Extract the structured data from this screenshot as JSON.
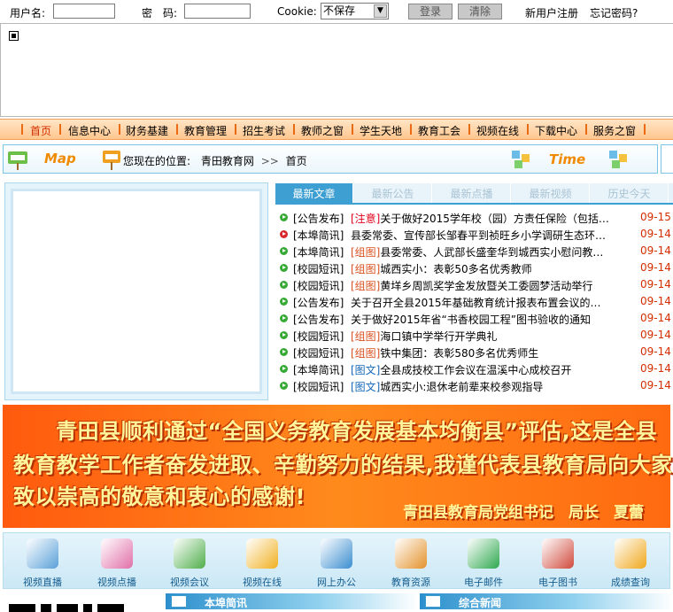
{
  "login": {
    "username_label": "用户名:",
    "password_label": "密　码:",
    "cookie_label": "Cookie:",
    "cookie_value": "不保存",
    "login_button": "登录",
    "clear_button": "清除",
    "register_link": "新用户注册",
    "forgot_link": "忘记密码?"
  },
  "nav": {
    "items": [
      "首页",
      "信息中心",
      "财务基建",
      "教育管理",
      "招生考试",
      "教师之窗",
      "学生天地",
      "教育工会",
      "视频在线",
      "下载中心",
      "服务之窗"
    ]
  },
  "location": {
    "map_text": "Map",
    "prefix": "您现在的位置:",
    "site": "青田教育网",
    "separator": ">>",
    "current": "首页",
    "time_text": "Time"
  },
  "tabs": [
    "最新文章",
    "最新公告",
    "最新点播",
    "最新视频",
    "历史今天"
  ],
  "news": [
    {
      "cat": "[公告发布]",
      "tag": "[注意]",
      "tag_color": "red",
      "title": "关于做好2015学年校（园）方责任保险（包括…",
      "date": "09-15",
      "icon": "green"
    },
    {
      "cat": "[本埠简讯]",
      "tag": "",
      "tag_color": "",
      "title": "县委常委、宣传部长邹春平到祯旺乡小学调研生态环…",
      "date": "09-14",
      "icon": "red"
    },
    {
      "cat": "[本埠简讯]",
      "tag": "[组图]",
      "tag_color": "red",
      "title": "县委常委、人武部长盛奎华到城西实小慰问教…",
      "date": "09-14",
      "icon": "green"
    },
    {
      "cat": "[校园短讯]",
      "tag": "[组图]",
      "tag_color": "red",
      "title": "城西实小：表彰50多名优秀教师",
      "date": "09-14",
      "icon": "green"
    },
    {
      "cat": "[校园短讯]",
      "tag": "[组图]",
      "tag_color": "red",
      "title": "黄垟乡周凯奖学金发放暨关工委圆梦活动举行",
      "date": "09-14",
      "icon": "green"
    },
    {
      "cat": "[公告发布]",
      "tag": "",
      "tag_color": "",
      "title": "关于召开全县2015年基础教育统计报表布置会议的通…",
      "date": "09-14",
      "icon": "green"
    },
    {
      "cat": "[公告发布]",
      "tag": "",
      "tag_color": "",
      "title": "关于做好2015年省“书香校园工程”图书验收的通知",
      "date": "09-14",
      "icon": "green"
    },
    {
      "cat": "[校园短讯]",
      "tag": "[组图]",
      "tag_color": "red",
      "title": "海口镇中学举行开学典礼",
      "date": "09-14",
      "icon": "green"
    },
    {
      "cat": "[校园短讯]",
      "tag": "[组图]",
      "tag_color": "red",
      "title": "铁中集团：表彰580多名优秀师生",
      "date": "09-14",
      "icon": "green"
    },
    {
      "cat": "[本埠简讯]",
      "tag": "[图文]",
      "tag_color": "blue",
      "title": "全县成技校工作会议在温溪中心成校召开",
      "date": "09-14",
      "icon": "green"
    },
    {
      "cat": "[校园短讯]",
      "tag": "[图文]",
      "tag_color": "blue",
      "title": "城西实小:退休老前辈来校参观指导",
      "date": "09-14",
      "icon": "green"
    }
  ],
  "banner": {
    "line1": "青田县顺利通过“全国义务教育发展基本均衡县”评估,这是全县",
    "line2": "教育教学工作者奋发进取、辛勤努力的结果,我谨代表县教育局向大家",
    "line3": "致以崇高的敬意和衷心的感谢!",
    "signature": "青田县教育局党组书记　局长　夏蕾"
  },
  "services": [
    {
      "label": "视频直播",
      "color": "#5aa0d8"
    },
    {
      "label": "视频点播",
      "color": "#e16fa8"
    },
    {
      "label": "视频会议",
      "color": "#4fae4a"
    },
    {
      "label": "视频在线",
      "color": "#f0b020"
    },
    {
      "label": "网上办公",
      "color": "#3b8ed0"
    },
    {
      "label": "教育资源",
      "color": "#e4922c"
    },
    {
      "label": "电子邮件",
      "color": "#2fa84f"
    },
    {
      "label": "电子图书",
      "color": "#d04a3c"
    },
    {
      "label": "成绩查询",
      "color": "#f0a81c"
    }
  ],
  "sections": {
    "left": "本埠简讯",
    "right": "综合新闻"
  }
}
